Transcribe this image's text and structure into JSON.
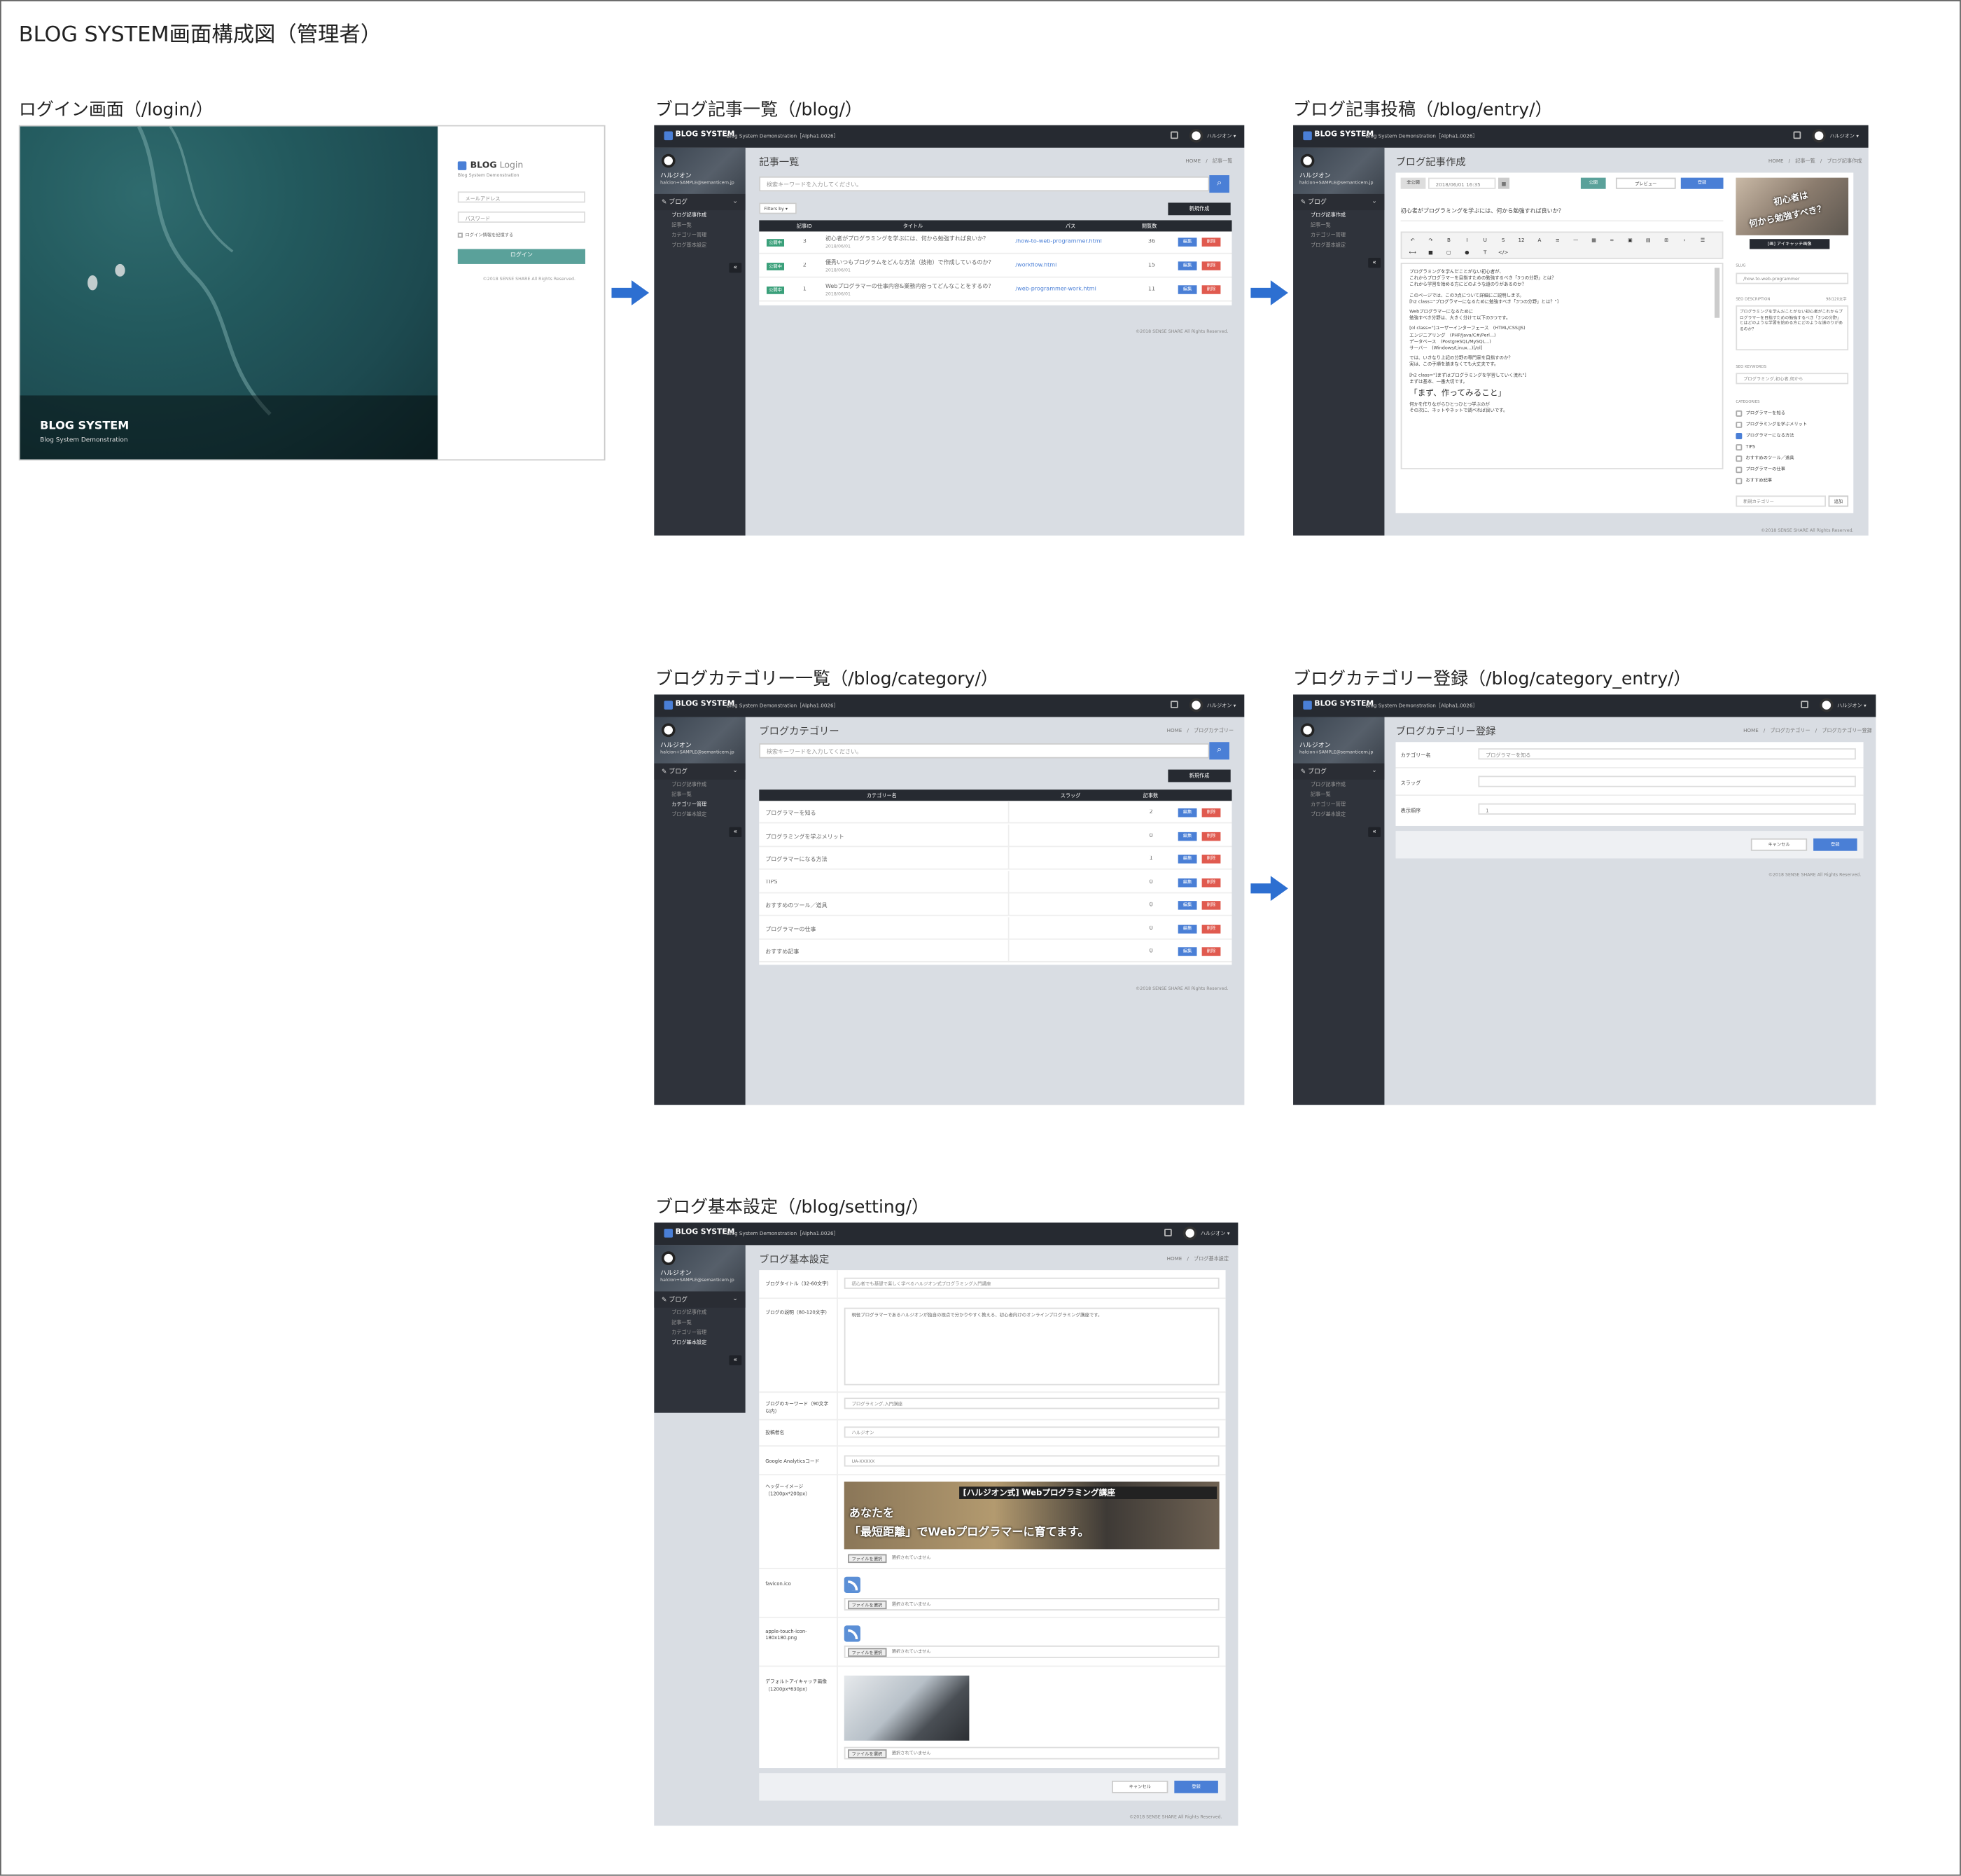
{
  "title": "BLOG SYSTEM画面構成図（管理者）",
  "captions": {
    "login": "ログイン画面（/login/）",
    "blog_list": "ブログ記事一覧（/blog/）",
    "blog_entry": "ブログ記事投稿（/blog/entry/）",
    "category_list": "ブログカテゴリー一覧（/blog/category/）",
    "category_entry": "ブログカテゴリー登録（/blog/category_entry/）",
    "setting": "ブログ基本設定（/blog/setting/）"
  },
  "app": {
    "brand": "BLOG SYSTEM",
    "brand_sub": "Blog System Demonstration［Alpha1.0026］",
    "user_name": "ハルジオン",
    "user_email": "halcion+SAMPLE@semanticern.jp",
    "menu_head": "ブログ",
    "menu": [
      "ブログ記事作成",
      "記事一覧",
      "カテゴリー管理",
      "ブログ基本設定"
    ],
    "collapse": "«",
    "footer": "©2018 SENSE SHARE All Rights Reserved.",
    "home": "HOME"
  },
  "login": {
    "hero_title": "BLOG SYSTEM",
    "hero_sub": "Blog System Demonstration",
    "panel_title_a": "BLOG",
    "panel_title_b": "Login",
    "panel_sub": "Blog System Demonstration",
    "email_placeholder": "メールアドレス",
    "password_placeholder": "パスワード",
    "remember": "ログイン情報を記憶する",
    "submit": "ログイン",
    "footer": "©2018 SENSE SHARE All Rights Reserved."
  },
  "blog_list": {
    "page_title": "記事一覧",
    "crumb": "HOME　/　記事一覧",
    "search_placeholder": "検索キーワードを入力してください。",
    "filter": "Filters by ▾",
    "new_button": "新規作成",
    "headers": [
      "記事ID",
      "タイトル",
      "パス",
      "閲覧数"
    ],
    "rows": [
      {
        "status": "公開中",
        "id": "3",
        "title": "初心者がプログラミングを学ぶには、何から勉強すれば良いか？",
        "date": "2018/06/01",
        "path": "/how-to-web-programmer.html",
        "views": "36"
      },
      {
        "status": "公開中",
        "id": "2",
        "title": "優秀いつもプログラムをどんな方法（技術）で作成しているのか？",
        "date": "2018/06/01",
        "path": "/workflow.html",
        "views": "15"
      },
      {
        "status": "公開中",
        "id": "1",
        "title": "Webプログラマーの仕事内容&業務内容ってどんなことをするの？",
        "date": "2018/06/01",
        "path": "/web-programmer-work.html",
        "views": "11"
      }
    ],
    "edit": "編集",
    "delete": "削除"
  },
  "blog_entry": {
    "page_title": "ブログ記事作成",
    "crumb": "HOME　/　記事一覧　/　ブログ記事作成",
    "status": "非公開",
    "date_value": "2018/06/01 16:35",
    "publish": "公開",
    "preview": "プレビュー",
    "save": "登録",
    "article_title": "初心者がプログラミングを学ぶには、何から勉強すれば良いか？",
    "body_lines": [
      "プログラミングを学んだことがない初心者が、",
      "これからプログラマーを目指すための勉強するべき「3つの分野」とは？",
      "これから学習を始める方にどのような道のりがあるのか？",
      "このページでは、この3点について詳細にご説明します。",
      "[h2 class=\"プログラマーになるために勉強すべき「3つの分野」とは？\"]",
      "Webプログラマーになるために",
      "勉強すべき分野は、大きく分けて以下の3つです。",
      "[ol class=\"]ユーザーインターフェース　(HTML/CSS/JS)",
      "エンジニアリング　(PHP/Java/C#/Perl...)",
      "データベース　(PostgreSQL/MySQL...)",
      "サーバー　(Windows/Linux...)[/ol]",
      "では、いきなり上記の分野の専門家を目指すのか？",
      "実は、この手順を踏まなくても大丈夫です。",
      "[h2 class=\"]まずはプログラミングを学習していく流れ\"]",
      "まずは基本、一番大切です。"
    ],
    "body_heading": "「まず、作ってみること」",
    "body_tail": [
      "何かを作りながらひとつひとつ学ぶのが",
      "その次に、ネットやネットで調べれば良いです。"
    ],
    "eyecatch_l1": "初心者は",
    "eyecatch_l2": "何から勉強すべき？",
    "eyecatch_btn": "[画] アイキャッチ画像",
    "slug_label": "SLUG",
    "slug_value": "/how-to-web-programmer",
    "seo_desc_label": "SEO DESCRIPTION",
    "seo_desc_count": "98/120文字",
    "seo_desc_value": "プログラミングを学んだことがない初心者がこれからプログラマーを目指すための勉強するべき「3つの分野」とはどのような学習を始める方にどのような道のりがあるのか？",
    "seo_kw_label": "SEO KEYWORDS",
    "seo_kw_value": "プログラミング,初心者,何から",
    "cat_label": "CATEGORIES",
    "categories": [
      {
        "name": "プログラマーを知る",
        "checked": false
      },
      {
        "name": "プログラミングを学ぶメリット",
        "checked": false
      },
      {
        "name": "プログラマーになる方法",
        "checked": true
      },
      {
        "name": "TIPS",
        "checked": false
      },
      {
        "name": "おすすめのツール／道具",
        "checked": false
      },
      {
        "name": "プログラマーの仕事",
        "checked": false
      },
      {
        "name": "おすすめ記事",
        "checked": false
      }
    ],
    "new_cat_placeholder": "新規カテゴリー",
    "new_cat_btn": "追加",
    "toolbar_glyphs": [
      "↶",
      "↷",
      "B",
      "I",
      "U",
      "S",
      "12",
      "A",
      "≡",
      "—",
      "▦",
      "∞",
      "▣",
      "▤",
      "⊞",
      "›",
      "☰",
      "⟷",
      "■",
      "▢",
      "●",
      "T",
      "</>"
    ]
  },
  "category_list": {
    "page_title": "ブログカテゴリー",
    "crumb": "HOME　/　ブログカテゴリー",
    "search_placeholder": "検索キーワードを入力してください。",
    "new_button": "新規作成",
    "headers": [
      "カテゴリー名",
      "スラッグ",
      "記事数"
    ],
    "rows": [
      {
        "name": "プログラマーを知る",
        "count": "2"
      },
      {
        "name": "プログラミングを学ぶメリット",
        "count": "0"
      },
      {
        "name": "プログラマーになる方法",
        "count": "1"
      },
      {
        "name": "TIPS",
        "count": "0"
      },
      {
        "name": "おすすめのツール／道具",
        "count": "0"
      },
      {
        "name": "プログラマーの仕事",
        "count": "0"
      },
      {
        "name": "おすすめ記事",
        "count": "0"
      }
    ],
    "edit": "編集",
    "delete": "削除"
  },
  "category_entry": {
    "page_title": "ブログカテゴリー登録",
    "crumb": "HOME　/　ブログカテゴリー　/　ブログカテゴリー登録",
    "fields": [
      {
        "label": "カテゴリー名",
        "value": "プログラマーを知る"
      },
      {
        "label": "スラッグ",
        "value": ""
      },
      {
        "label": "表示順序",
        "value": "1"
      }
    ],
    "cancel": "キャンセル",
    "save": "登録"
  },
  "setting": {
    "page_title": "ブログ基本設定",
    "crumb": "HOME　/　ブログ基本設定",
    "blog_title_label": "ブログタイトル（32-60文字）",
    "blog_title_value": "初心者でも基礎で楽しく学べるハルジオン式プログラミング入門講座",
    "blog_desc_label": "ブログの説明（80-120文字）",
    "blog_desc_value": "現役プログラマーであるハルジオンが独自の視点で分かりやすく教える、初心者向けのオンラインプログラミング講座です。",
    "keywords_label": "ブログのキーワード（90文字以内）",
    "keywords_value": "プログラミング,入門講座",
    "author_label": "投稿者名",
    "author_value": "ハルジオン",
    "ga_label": "Google Analyticsコード",
    "ga_value": "UA-XXXXX",
    "header_label": "ヘッダーイメージ（1200px*200px）",
    "banner_l1": "[ハルジオン式] Webプログラミング講座",
    "banner_l2": "あなたを",
    "banner_l3": "「最短距離」でWebプログラマーに育てます。",
    "favicon_label": "favicon.ico",
    "apple_label": "apple-touch-icon-180x180.png",
    "default_eye_label": "デフォルトアイキャッチ画像（1200px*630px）",
    "file_btn": "ファイルを選択",
    "no_file": "選択されていません",
    "cancel": "キャンセル",
    "save": "登録"
  }
}
